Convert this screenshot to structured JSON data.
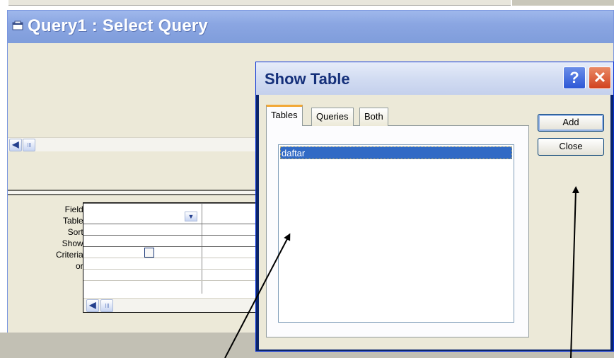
{
  "query_window": {
    "title": "Query1 : Select Query",
    "title_icon": "query-window-icon"
  },
  "design_grid": {
    "row_labels": [
      "Field:",
      "Table:",
      "Sort:",
      "Show:",
      "Criteria:",
      "or:"
    ],
    "field_dropdown_icon": "chevron-down-icon",
    "scroll_left_icon": "arrow-left-icon"
  },
  "show_table_dialog": {
    "title": "Show Table",
    "help_label": "?",
    "close_label": "✕",
    "tabs": [
      {
        "label": "Tables",
        "selected": true
      },
      {
        "label": "Queries",
        "selected": false
      },
      {
        "label": "Both",
        "selected": false
      }
    ],
    "tables": [
      {
        "name": "daftar",
        "selected": true
      }
    ],
    "buttons": {
      "add_label": "Add",
      "close_label": "Close"
    }
  },
  "colors": {
    "window_titlebar": "#8ba6e2",
    "dialog_titlebar": "#d2dcf2",
    "selection": "#316ac5",
    "panel": "#ece9d8"
  }
}
